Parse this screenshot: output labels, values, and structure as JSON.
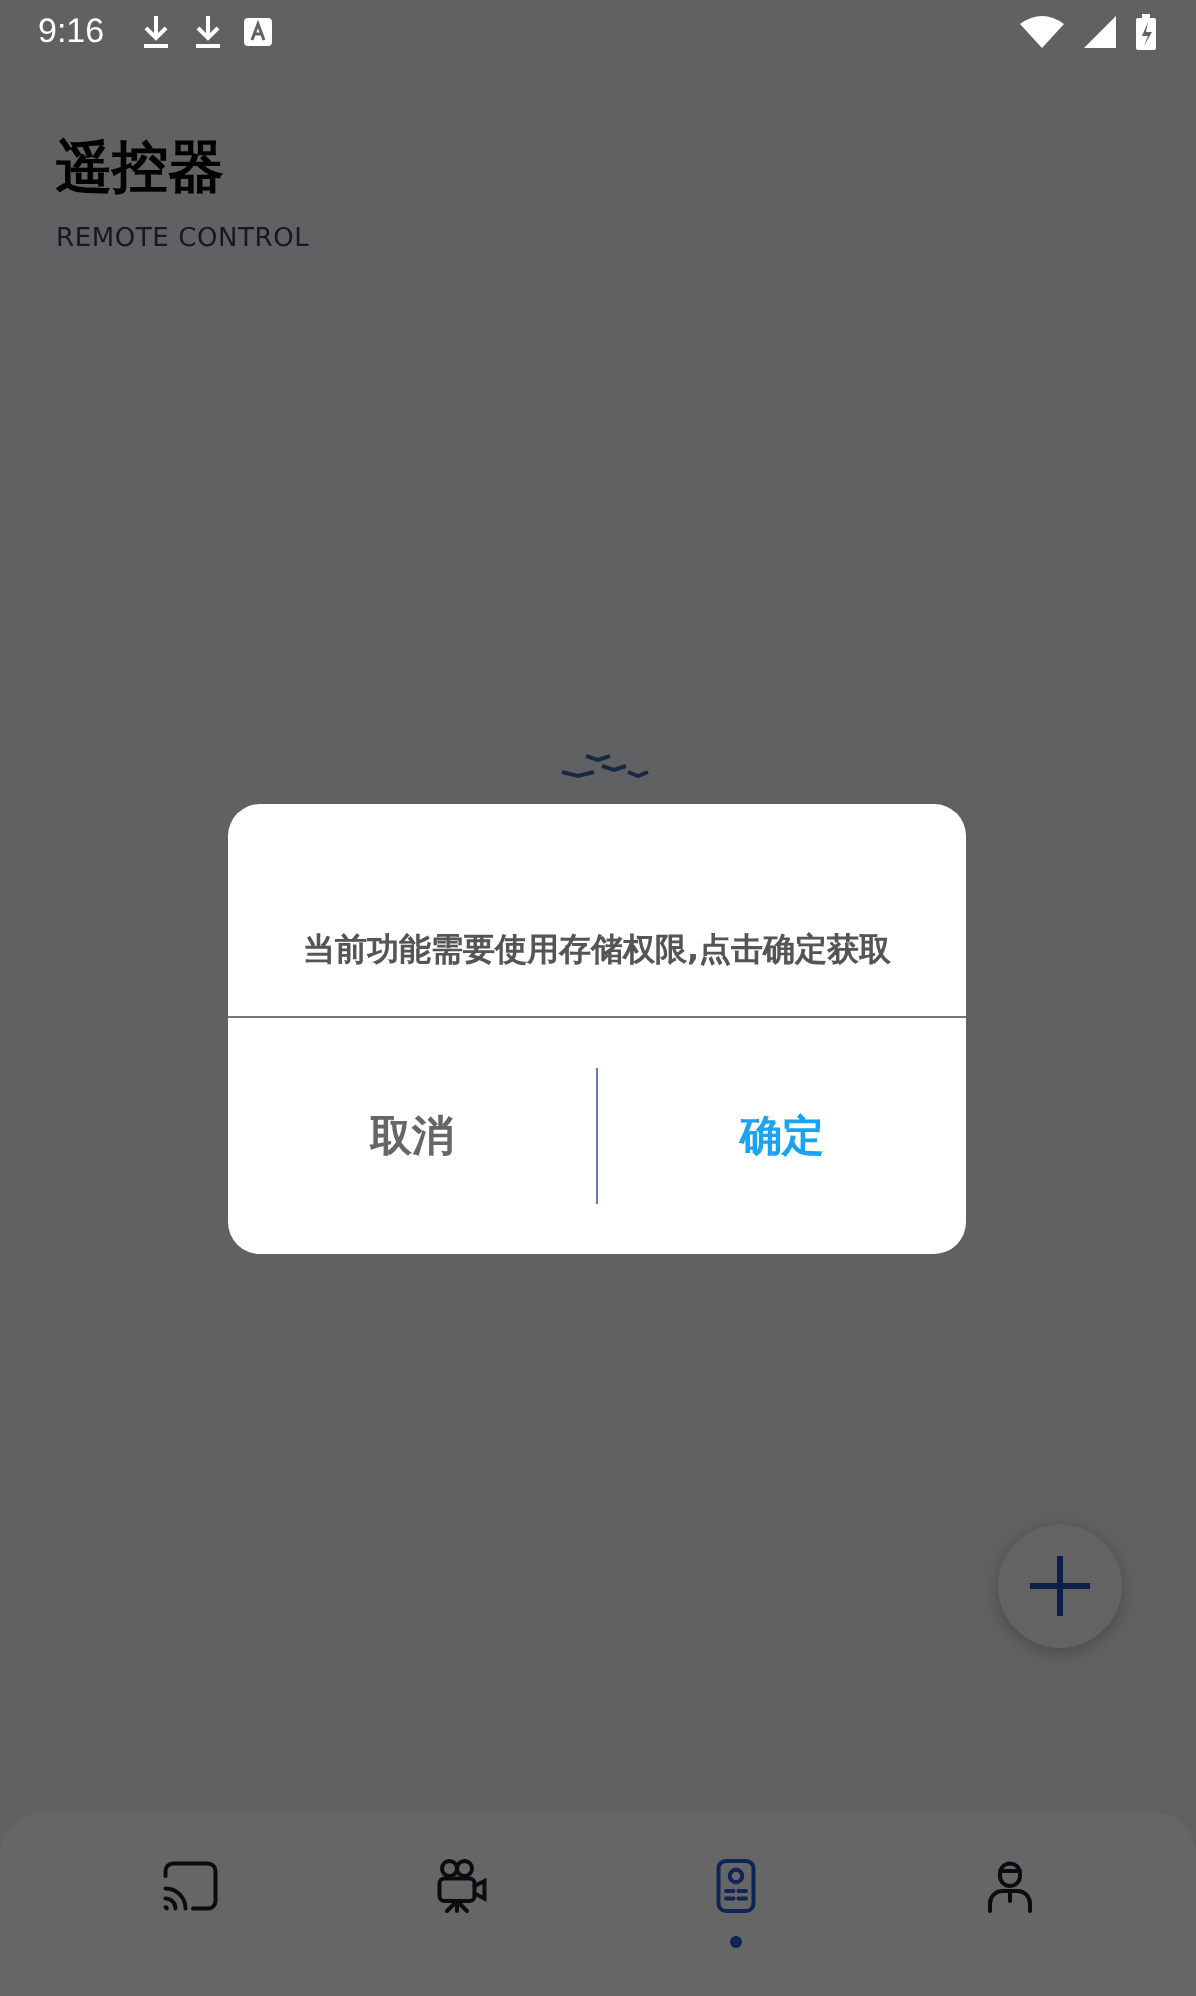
{
  "status_bar": {
    "time": "9:16"
  },
  "header": {
    "title": "遥控器",
    "subtitle": "REMOTE CONTROL"
  },
  "dialog": {
    "message": "当前功能需要使用存储权限,点击确定获取",
    "buttons": [
      {
        "label": "取消",
        "kind": "cancel"
      },
      {
        "label": "确定",
        "kind": "confirm"
      }
    ]
  },
  "bottom_nav": [
    {
      "kind": "cast",
      "selected": false
    },
    {
      "kind": "camera",
      "selected": false
    },
    {
      "kind": "remote",
      "selected": true
    },
    {
      "kind": "profile",
      "selected": false
    }
  ]
}
